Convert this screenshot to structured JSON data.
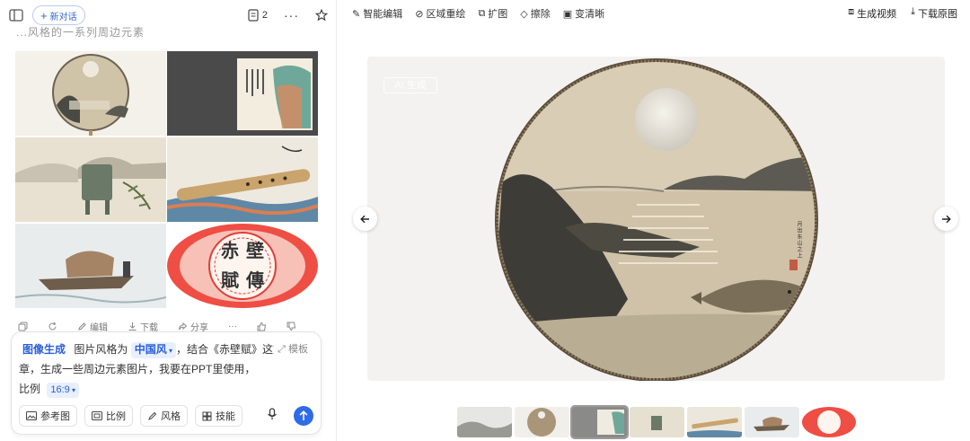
{
  "left": {
    "new_chat": "新对话",
    "doc_count": "2",
    "faded_title": "...风格的一系列周边元素"
  },
  "result_actions": {
    "edit": "编辑",
    "download": "下载",
    "share": "分享"
  },
  "composer": {
    "skill_tag": "图像生成",
    "style_prefix": "图片风格为",
    "style_value": "中国风",
    "text_main": "，结合《赤壁赋》这篇文章，生成一些周边元素图片，我要在PPT里使用，",
    "ratio_prefix": "比例",
    "ratio_value": "16:9",
    "template": "模板",
    "tools": [
      "参考图",
      "比例",
      "风格",
      "技能"
    ]
  },
  "editor": {
    "tools": [
      "智能编辑",
      "区域重绘",
      "扩图",
      "擦除",
      "变清晰"
    ],
    "generate_video": "生成视频",
    "download_original": "下载原图",
    "watermark": "AI 生成"
  },
  "fan_seal": {
    "text": "月出东山之上"
  },
  "red_seal": {
    "chars": [
      "赤",
      "壁",
      "賦",
      "傳"
    ]
  },
  "colors": {
    "accent": "#2f6ae8",
    "red": "#e23c35"
  }
}
